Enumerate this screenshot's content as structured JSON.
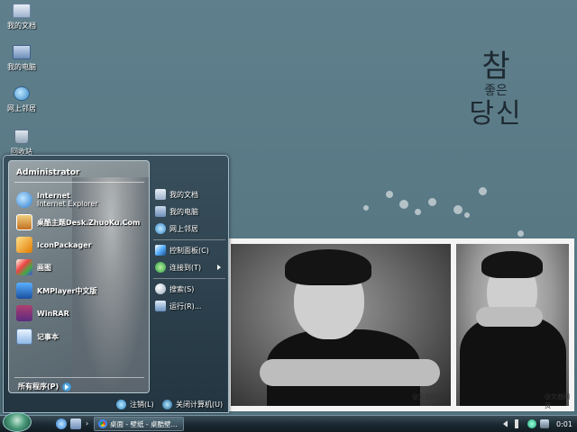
{
  "desktop": {
    "icons": [
      {
        "label": "我的文档",
        "icon": "documents-icon"
      },
      {
        "label": "我的电脑",
        "icon": "computer-icon"
      },
      {
        "label": "网上邻居",
        "icon": "network-icon"
      },
      {
        "label": "回收站",
        "icon": "recycle-bin-icon"
      }
    ],
    "wallpaper_text": [
      "참",
      "좋은",
      "당신"
    ],
    "photo_watermark": "@文曲网页"
  },
  "start_menu": {
    "user": "Administrator",
    "pinned": [
      {
        "title": "Internet",
        "subtitle": "Internet Explorer",
        "icon": "ie-icon"
      },
      {
        "title": "桌酷主题Desk.ZhuoKu.Com",
        "icon": "zhuoku-icon"
      },
      {
        "title": "IconPackager",
        "icon": "iconpackager-icon"
      },
      {
        "title": "画图",
        "icon": "paint-icon"
      },
      {
        "title": "KMPlayer中文版",
        "icon": "kmplayer-icon"
      },
      {
        "title": "WinRAR",
        "icon": "winrar-icon"
      },
      {
        "title": "记事本",
        "icon": "notepad-icon"
      }
    ],
    "all_programs": "所有程序(P)",
    "right": [
      {
        "label": "我的文档",
        "icon": "documents-icon"
      },
      {
        "label": "我的电脑",
        "icon": "computer-icon"
      },
      {
        "label": "网上邻居",
        "icon": "network-icon"
      },
      {
        "label": "控制面板(C)",
        "icon": "control-panel-icon"
      },
      {
        "label": "连接到(T)",
        "icon": "connect-icon"
      },
      {
        "label": "搜索(S)",
        "icon": "search-icon"
      },
      {
        "label": "运行(R)...",
        "icon": "run-icon"
      }
    ],
    "logoff": "注销(L)",
    "shutdown": "关闭计算机(U)"
  },
  "taskbar": {
    "task_label": "桌面 - 壁纸 - 桌酷壁...",
    "clock": "0:01"
  }
}
